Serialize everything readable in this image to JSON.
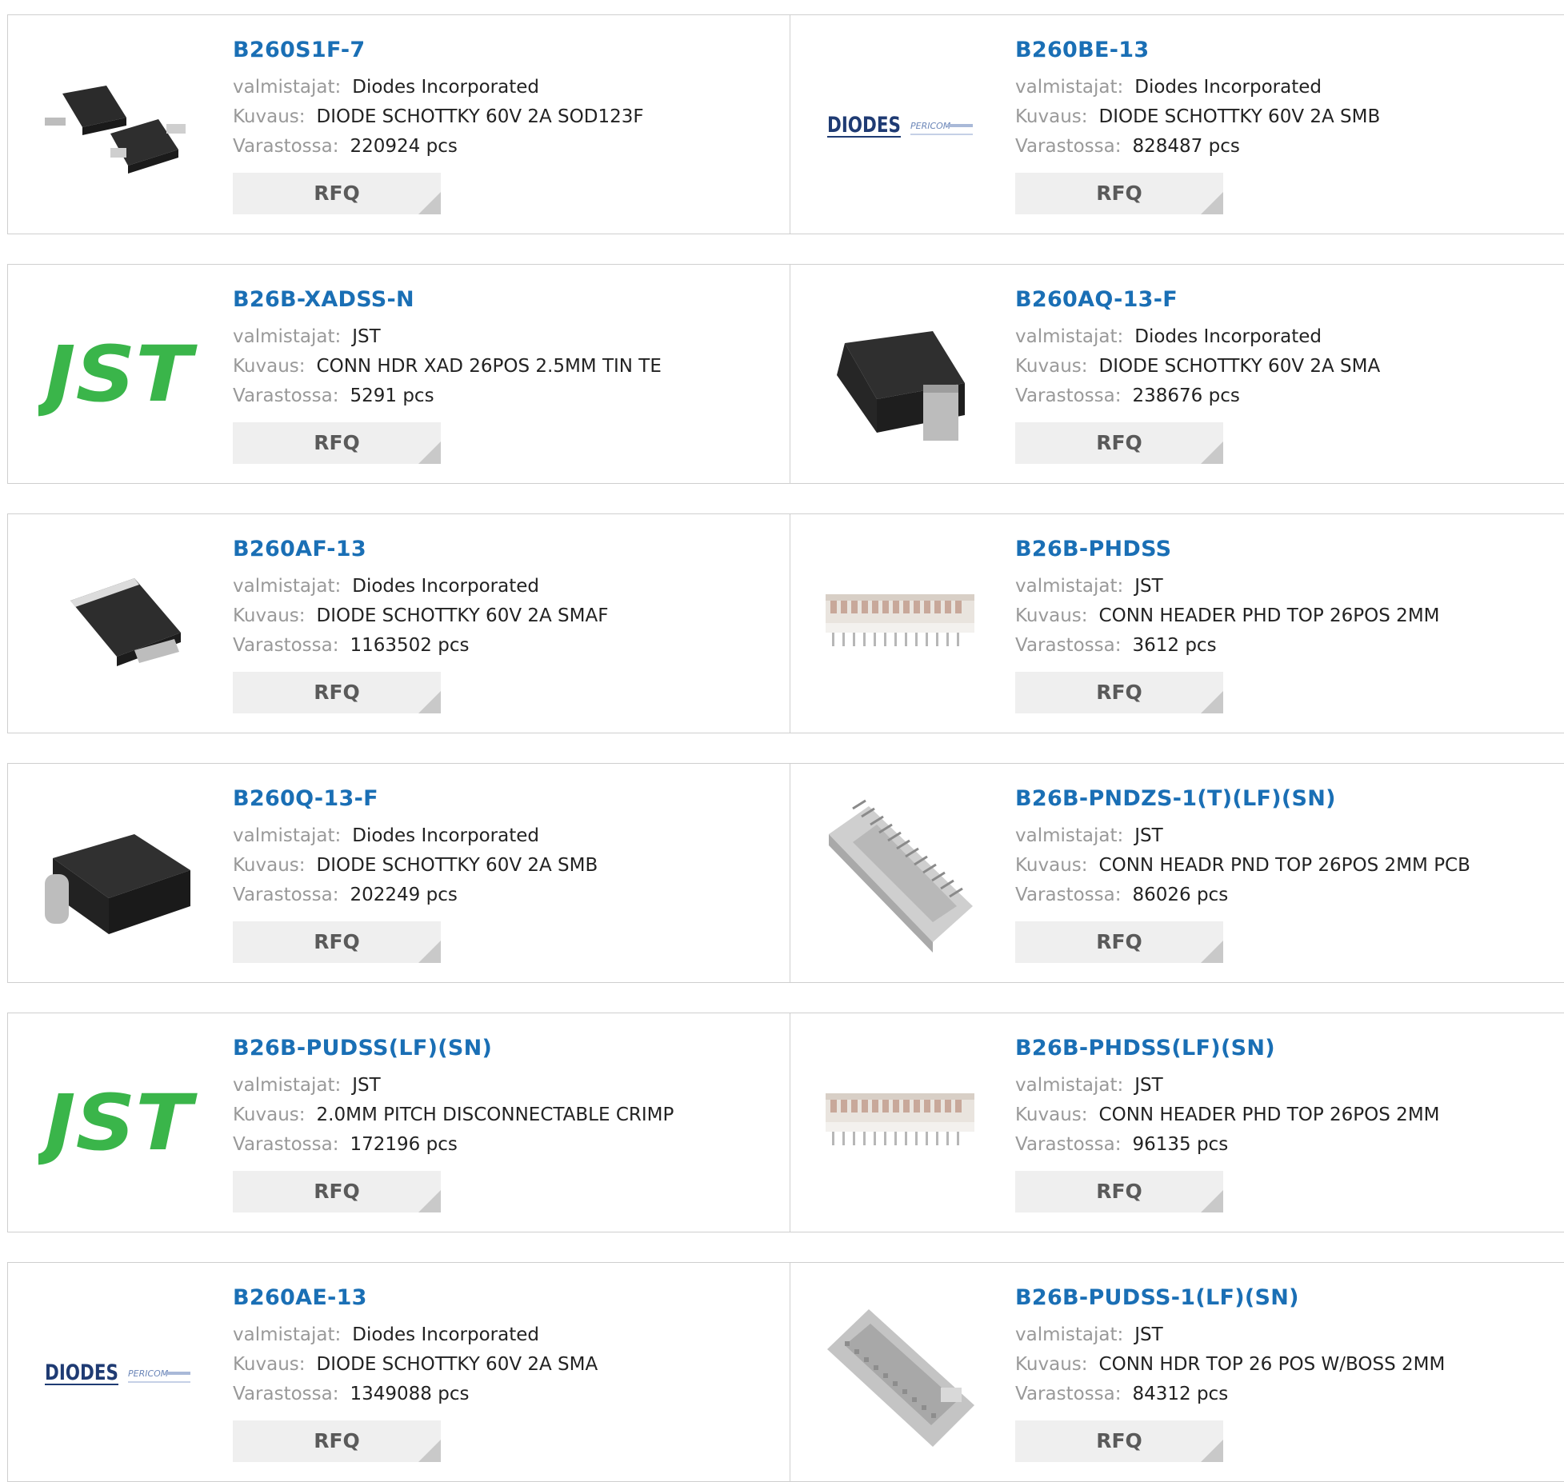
{
  "labels": {
    "manufacturer": "valmistajat:",
    "description": "Kuvaus:",
    "stock": "Varastossa:",
    "rfq": "RFQ"
  },
  "products": [
    {
      "part": "B260S1F-7",
      "manufacturer": "Diodes Incorporated",
      "description": "DIODE SCHOTTKY 60V 2A SOD123F",
      "stock": "220924 pcs",
      "image": "sod123f-package"
    },
    {
      "part": "B260BE-13",
      "manufacturer": "Diodes Incorporated",
      "description": "DIODE SCHOTTKY 60V 2A SMB",
      "stock": "828487 pcs",
      "image": "diodes-logo",
      "logo_text": "DIODES",
      "logo_sub": "PERICOM"
    },
    {
      "part": "B26B-XADSS-N",
      "manufacturer": "JST",
      "description": "CONN HDR XAD 26POS 2.5MM TIN TE",
      "stock": "5291 pcs",
      "image": "jst-logo",
      "logo_text": "JST"
    },
    {
      "part": "B260AQ-13-F",
      "manufacturer": "Diodes Incorporated",
      "description": "DIODE SCHOTTKY 60V 2A SMA",
      "stock": "238676 pcs",
      "image": "sma-package"
    },
    {
      "part": "B260AF-13",
      "manufacturer": "Diodes Incorporated",
      "description": "DIODE SCHOTTKY 60V 2A SMAF",
      "stock": "1163502 pcs",
      "image": "smaf-package"
    },
    {
      "part": "B26B-PHDSS",
      "manufacturer": "JST",
      "description": "CONN HEADER PHD TOP 26POS 2MM",
      "stock": "3612 pcs",
      "image": "phd-header"
    },
    {
      "part": "B260Q-13-F",
      "manufacturer": "Diodes Incorporated",
      "description": "DIODE SCHOTTKY 60V 2A SMB",
      "stock": "202249 pcs",
      "image": "smb-package"
    },
    {
      "part": "B26B-PNDZS-1(T)(LF)(SN)",
      "manufacturer": "JST",
      "description": "CONN HEADR PND TOP 26POS 2MM PCB",
      "stock": "86026 pcs",
      "image": "pnd-header"
    },
    {
      "part": "B26B-PUDSS(LF)(SN)",
      "manufacturer": "JST",
      "description": "2.0MM PITCH DISCONNECTABLE CRIMP",
      "stock": "172196 pcs",
      "image": "jst-logo",
      "logo_text": "JST"
    },
    {
      "part": "B26B-PHDSS(LF)(SN)",
      "manufacturer": "JST",
      "description": "CONN HEADER PHD TOP 26POS 2MM",
      "stock": "96135 pcs",
      "image": "phd-header"
    },
    {
      "part": "B260AE-13",
      "manufacturer": "Diodes Incorporated",
      "description": "DIODE SCHOTTKY 60V 2A SMA",
      "stock": "1349088 pcs",
      "image": "diodes-logo",
      "logo_text": "DIODES",
      "logo_sub": "PERICOM"
    },
    {
      "part": "B26B-PUDSS-1(LF)(SN)",
      "manufacturer": "JST",
      "description": "CONN HDR TOP 26 POS W/BOSS 2MM",
      "stock": "84312 pcs",
      "image": "pud-header"
    }
  ],
  "colors": {
    "link": "#1a6fb5",
    "label": "#999999",
    "value": "#222222",
    "button_bg": "#efefef",
    "jst_green": "#3ab54a"
  }
}
